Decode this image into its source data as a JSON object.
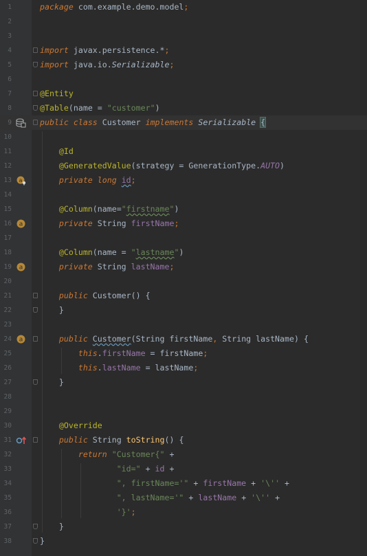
{
  "editor": {
    "lines": [
      {
        "num": "1",
        "code": "package com.example.demo.model;"
      },
      {
        "num": "2",
        "code": ""
      },
      {
        "num": "3",
        "code": ""
      },
      {
        "num": "4",
        "code": "import javax.persistence.*;"
      },
      {
        "num": "5",
        "code": "import java.io.Serializable;"
      },
      {
        "num": "6",
        "code": ""
      },
      {
        "num": "7",
        "code": "@Entity"
      },
      {
        "num": "8",
        "code": "@Table(name = \"customer\")"
      },
      {
        "num": "9",
        "code": "public class Customer implements Serializable {"
      },
      {
        "num": "10",
        "code": ""
      },
      {
        "num": "11",
        "code": "    @Id"
      },
      {
        "num": "12",
        "code": "    @GeneratedValue(strategy = GenerationType.AUTO)"
      },
      {
        "num": "13",
        "code": "    private long id;"
      },
      {
        "num": "14",
        "code": ""
      },
      {
        "num": "15",
        "code": "    @Column(name=\"firstname\")"
      },
      {
        "num": "16",
        "code": "    private String firstName;"
      },
      {
        "num": "17",
        "code": ""
      },
      {
        "num": "18",
        "code": "    @Column(name = \"lastname\")"
      },
      {
        "num": "19",
        "code": "    private String lastName;"
      },
      {
        "num": "20",
        "code": ""
      },
      {
        "num": "21",
        "code": "    public Customer() {"
      },
      {
        "num": "22",
        "code": "    }"
      },
      {
        "num": "23",
        "code": ""
      },
      {
        "num": "24",
        "code": "    public Customer(String firstName, String lastName) {"
      },
      {
        "num": "25",
        "code": "        this.firstName = firstName;"
      },
      {
        "num": "26",
        "code": "        this.lastName = lastName;"
      },
      {
        "num": "27",
        "code": "    }"
      },
      {
        "num": "28",
        "code": ""
      },
      {
        "num": "29",
        "code": ""
      },
      {
        "num": "30",
        "code": "    @Override"
      },
      {
        "num": "31",
        "code": "    public String toString() {"
      },
      {
        "num": "32",
        "code": "        return \"Customer{\" +"
      },
      {
        "num": "33",
        "code": "                \"id=\" + id +"
      },
      {
        "num": "34",
        "code": "                \", firstName='\" + firstName + '\\'' +"
      },
      {
        "num": "35",
        "code": "                \", lastName='\" + lastName + '\\'' +"
      },
      {
        "num": "36",
        "code": "                '}';"
      },
      {
        "num": "37",
        "code": "    }"
      },
      {
        "num": "38",
        "code": "}"
      }
    ],
    "current_line": 9,
    "gutter_icons": [
      {
        "line": 9,
        "icon": "database-icon"
      },
      {
        "line": 13,
        "icon": "key-field-icon"
      },
      {
        "line": 16,
        "icon": "column-icon"
      },
      {
        "line": 19,
        "icon": "column-icon"
      },
      {
        "line": 24,
        "icon": "column-icon"
      },
      {
        "line": 31,
        "icon": "override-method-icon"
      }
    ],
    "colors": {
      "background": "#2b2b2b",
      "gutter": "#313335",
      "keyword": "#cc7832",
      "annotation": "#bbb529",
      "string": "#6a8759",
      "field": "#9876aa",
      "text": "#a9b7c6"
    }
  }
}
